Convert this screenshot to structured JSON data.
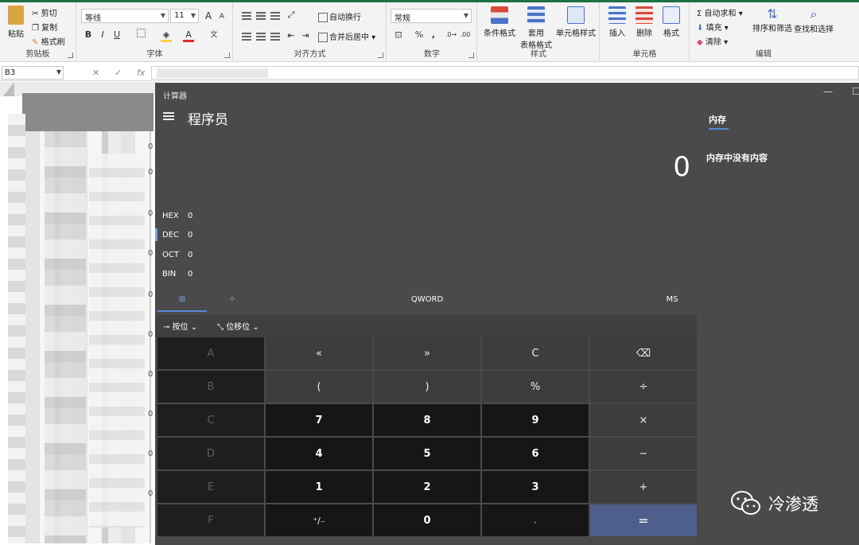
{
  "ribbon": {
    "clipboard": {
      "group": "剪贴板",
      "paste": "粘贴",
      "cut": "剪切",
      "copy": "复制",
      "format_painter": "格式刷"
    },
    "font": {
      "group": "字体",
      "font_name": "等线",
      "font_size": "11",
      "bold": "B",
      "italic": "I",
      "underline": "U",
      "grow": "A",
      "shrink": "A",
      "font_color_letter": "A",
      "font_color": "#e12b2b",
      "fill_color": "#f7d14a"
    },
    "alignment": {
      "group": "对齐方式",
      "wrap_text": "自动换行",
      "merge_center": "合并后居中"
    },
    "number": {
      "group": "数字",
      "format": "常规",
      "percent": "%",
      "comma": ","
    },
    "styles": {
      "group": "样式",
      "conditional": "条件格式",
      "table_format_1": "套用",
      "table_format_2": "表格格式",
      "cell_styles": "单元格样式"
    },
    "cells": {
      "group": "单元格",
      "insert": "插入",
      "delete": "删除",
      "format": "格式"
    },
    "editing": {
      "group": "编辑",
      "autosum": "自动求和",
      "fill": "填充",
      "clear": "清除",
      "sort_filter": "排序和筛选",
      "find_select": "查找和选择"
    }
  },
  "formula_bar": {
    "name_box": "B3",
    "cancel": "✕",
    "enter": "✓",
    "fx": "fx"
  },
  "sheet": {
    "row_numbers": [
      "0",
      "0",
      "0",
      "0",
      "0",
      "0",
      "0",
      "0",
      "0",
      "0"
    ]
  },
  "calculator": {
    "title": "计算器",
    "mode": "程序员",
    "display": "0",
    "radix": [
      {
        "label": "HEX",
        "value": "0"
      },
      {
        "label": "DEC",
        "value": "0"
      },
      {
        "label": "OCT",
        "value": "0"
      },
      {
        "label": "BIN",
        "value": "0"
      }
    ],
    "word_size": "QWORD",
    "ms": "MS",
    "bitwise": "按位",
    "bitshift": "位移位",
    "memory_tab": "内存",
    "memory_empty": "内存中没有内容",
    "keys": [
      [
        "A",
        "«",
        "»",
        "C",
        "⌫"
      ],
      [
        "B",
        "(",
        ")",
        "%",
        "÷"
      ],
      [
        "C",
        "7",
        "8",
        "9",
        "×"
      ],
      [
        "D",
        "4",
        "5",
        "6",
        "−"
      ],
      [
        "E",
        "1",
        "2",
        "3",
        "+"
      ],
      [
        "F",
        "⁺∕₋",
        "0",
        ".",
        "="
      ]
    ],
    "accent": "#4e5f8c"
  },
  "watermark": {
    "text": "冷渗透"
  }
}
